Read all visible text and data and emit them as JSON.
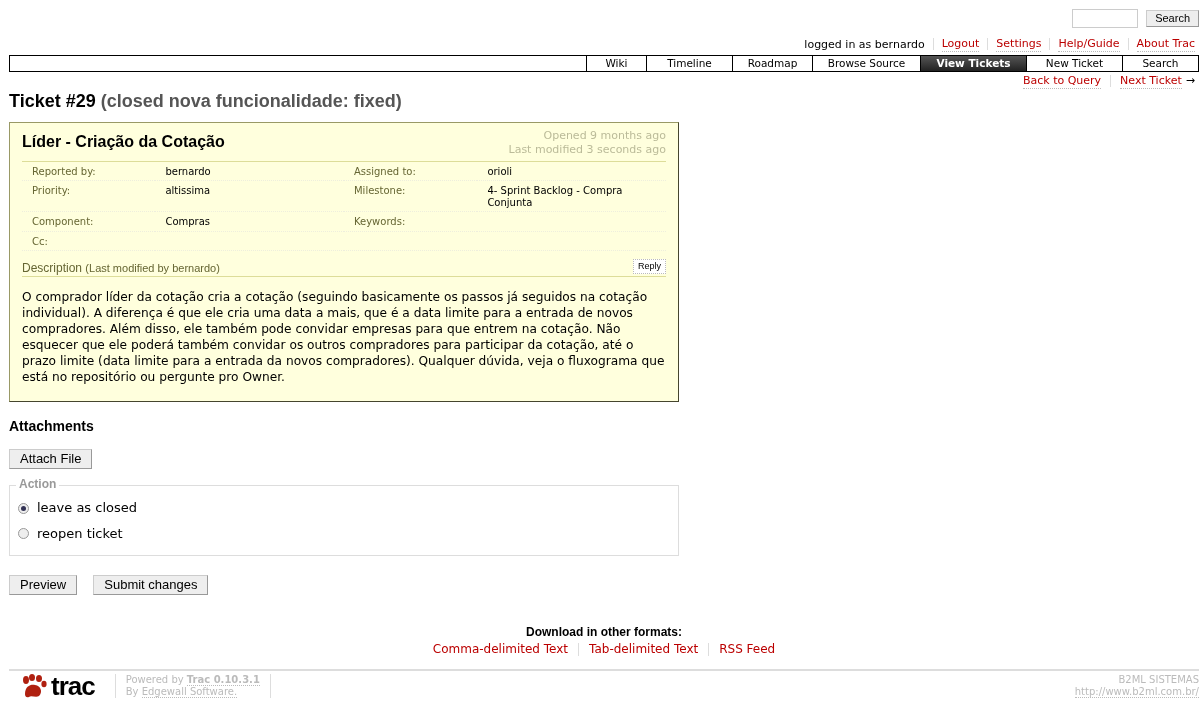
{
  "search": {
    "button": "Search"
  },
  "metanav": [
    {
      "label": "logged in as bernardo",
      "kind": "text"
    },
    {
      "label": "Logout",
      "kind": "link"
    },
    {
      "label": "Settings",
      "kind": "link"
    },
    {
      "label": "Help/Guide",
      "kind": "link"
    },
    {
      "label": "About Trac",
      "kind": "link"
    }
  ],
  "mainnav": [
    {
      "label": "Wiki",
      "selected": false
    },
    {
      "label": "Timeline",
      "selected": false
    },
    {
      "label": "Roadmap",
      "selected": false
    },
    {
      "label": "Browse Source",
      "selected": false
    },
    {
      "label": "View Tickets",
      "selected": true
    },
    {
      "label": "New Ticket",
      "selected": false
    },
    {
      "label": "Search",
      "selected": false
    }
  ],
  "ticket_nav": [
    {
      "label": "Back to Query"
    },
    {
      "label": "Next Ticket",
      "arrow": "→"
    }
  ],
  "title": {
    "ticket": "Ticket #29",
    "status": "(closed nova funcionalidade: fixed)"
  },
  "ticket": {
    "summary": "Líder - Criação da Cotação",
    "opened": "Opened 9 months ago",
    "modified": "Last modified 3 seconds ago",
    "fields": [
      [
        {
          "label": "Reported by:",
          "value": "bernardo"
        },
        {
          "label": "Assigned to:",
          "value": "orioli"
        }
      ],
      [
        {
          "label": "Priority:",
          "value": "altissima"
        },
        {
          "label": "Milestone:",
          "value": "4- Sprint Backlog - Compra Conjunta"
        }
      ],
      [
        {
          "label": "Component:",
          "value": "Compras"
        },
        {
          "label": "Keywords:"
        }
      ],
      [
        {
          "label": "Cc:"
        }
      ]
    ],
    "description_heading": "Description",
    "description_note": "(Last modified by bernardo)",
    "reply": "Reply",
    "description": "O comprador líder da cotação cria a cotação (seguindo basicamente os passos já seguidos na cotação individual). A diferença é que ele cria uma data a mais, que é a data limite para a entrada de novos compradores. Além disso, ele também pode convidar empresas para que entrem na cotação. Não esquecer que ele poderá também convidar os outros compradores para participar da cotação, até o prazo limite (data limite para a entrada da novos compradores). Qualquer dúvida, veja o fluxograma que está no repositório ou pergunte pro Owner."
  },
  "attachments": {
    "heading": "Attachments",
    "button": "Attach File"
  },
  "action": {
    "legend": "Action",
    "options": [
      {
        "label": "leave as closed",
        "selected": true
      },
      {
        "label": "reopen ticket",
        "selected": false
      }
    ]
  },
  "buttons": [
    "Preview",
    "Submit changes"
  ],
  "downloads": {
    "heading": "Download in other formats:",
    "links": [
      "Comma-delimited Text",
      "Tab-delimited Text",
      "RSS Feed"
    ]
  },
  "footer": {
    "logo": "trac",
    "powered": "Powered by",
    "version": "Trac 0.10.3.1",
    "by": "By",
    "company": "Edgewall Software.",
    "right_title": "B2ML SISTEMAS",
    "right_url": "http://www.b2ml.com.br/"
  }
}
